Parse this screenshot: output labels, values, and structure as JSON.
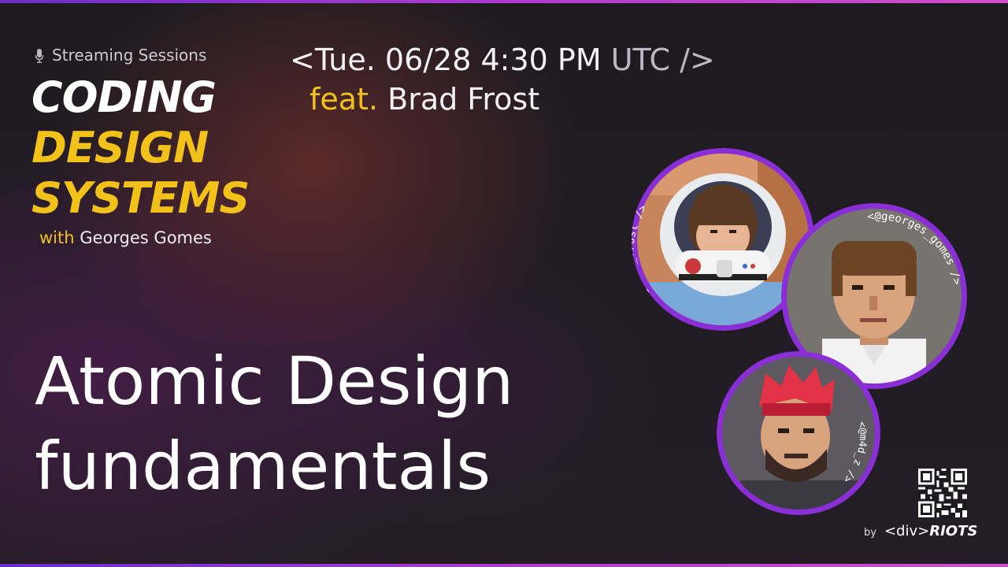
{
  "header": {
    "kicker_icon": "microphone-icon",
    "kicker": "Streaming Sessions",
    "show_title": [
      "CODING",
      "DESIGN",
      "SYSTEMS"
    ],
    "with_word": "with",
    "host": "Georges Gomes"
  },
  "event": {
    "date_open": "<Tue. 06/28 4:30 PM",
    "date_close": "UTC />",
    "feat_word": "feat.",
    "guest": "Brad Frost"
  },
  "episode": {
    "title_line1": "Atomic Design",
    "title_line2": "fundamentals"
  },
  "speakers": [
    {
      "handle": "<@brad_frost />",
      "portrait": "astronaut-helmet-photo"
    },
    {
      "handle": "<@georges_gomes />",
      "portrait": "pixel-art-portrait"
    },
    {
      "handle": "<@m4d_z />",
      "portrait": "pixel-art-portrait-red-hair"
    }
  ],
  "footer": {
    "by": "by",
    "logo_left": "<div>",
    "logo_right": "RIOTS",
    "qr_icon": "qr-code-icon"
  },
  "colors": {
    "accent_yellow": "#f2c21b",
    "ring_purple": "#8a2fd6",
    "edge_gradient": [
      "#6a2ec9",
      "#d04fcf"
    ]
  }
}
